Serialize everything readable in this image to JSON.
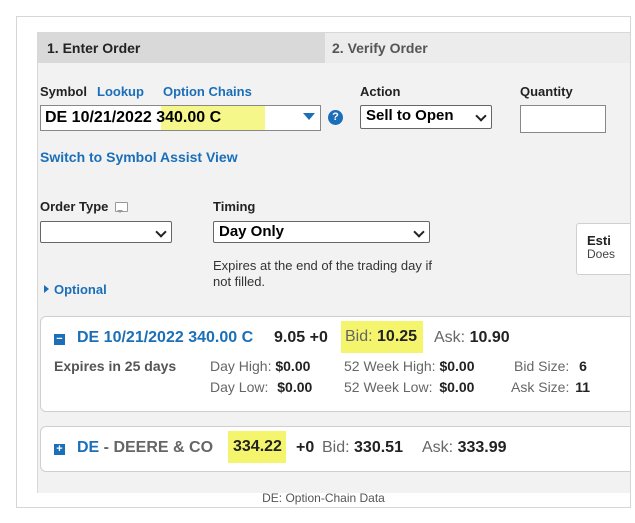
{
  "tabs": {
    "step1": "1. Enter Order",
    "step2": "2. Verify Order"
  },
  "symbol": {
    "label": "Symbol",
    "lookup_link": "Lookup",
    "option_chains_link": "Option Chains",
    "value_prefix": "DE 10/21/2022 ",
    "value_highlight": "340.00 C",
    "help_glyph": "?",
    "switch_link": "Switch to Symbol Assist View"
  },
  "action": {
    "label": "Action",
    "selected": "Sell to Open"
  },
  "quantity": {
    "label": "Quantity",
    "value": ""
  },
  "order_type": {
    "label": "Order Type",
    "selected": ""
  },
  "timing": {
    "label": "Timing",
    "selected": "Day Only",
    "description": "Expires at the end of the trading day if not filled."
  },
  "optional_link": "Optional",
  "estimate": {
    "title": "Esti",
    "subtitle": "Does"
  },
  "option_quote": {
    "toggle": "−",
    "contract": "DE 10/21/2022 340.00 C",
    "last": "9.05",
    "change": "+0",
    "bid_label": "Bid:",
    "bid": "10.25",
    "ask_label": "Ask:",
    "ask": "10.90",
    "expires_in": "Expires in 25 days",
    "day_high_label": "Day High:",
    "day_high": "$0.00",
    "day_low_label": "Day Low:",
    "day_low": "$0.00",
    "wk52_high_label": "52 Week High:",
    "wk52_high": "$0.00",
    "wk52_low_label": "52 Week Low:",
    "wk52_low": "$0.00",
    "bid_size_label": "Bid Size:",
    "bid_size": "6",
    "ask_size_label": "Ask Size:",
    "ask_size": "11"
  },
  "stock_quote": {
    "toggle": "+",
    "ticker": "DE",
    "name": " - DEERE & CO",
    "last": "334.22",
    "change": "+0",
    "bid_label": "Bid:",
    "bid": "330.51",
    "ask_label": "Ask:",
    "ask": "333.99"
  },
  "footer": "DE: Option-Chain Data",
  "colors": {
    "link_blue": "#1b6fb8",
    "highlight": "#f6f78a"
  }
}
